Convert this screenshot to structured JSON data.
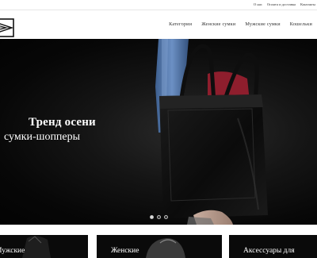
{
  "top_links": [
    "О нас",
    "Оплата и доставка",
    "Контакты"
  ],
  "nav": [
    "Категории",
    "Женские сумки",
    "Мужские сумки",
    "Кошельки"
  ],
  "hero": {
    "title": "Тренд осени",
    "subtitle": "сумки-шопперы",
    "slides_count": 3,
    "active_slide": 1
  },
  "tiles": [
    "Мужские",
    "Женские",
    "Аксессуары для"
  ],
  "icons": {
    "logo": "brand-logo-icon"
  },
  "colors": {
    "hero_bg": "#0a0a0a",
    "tile_bg": "#0a0a0a",
    "text_light": "#ffffff"
  }
}
